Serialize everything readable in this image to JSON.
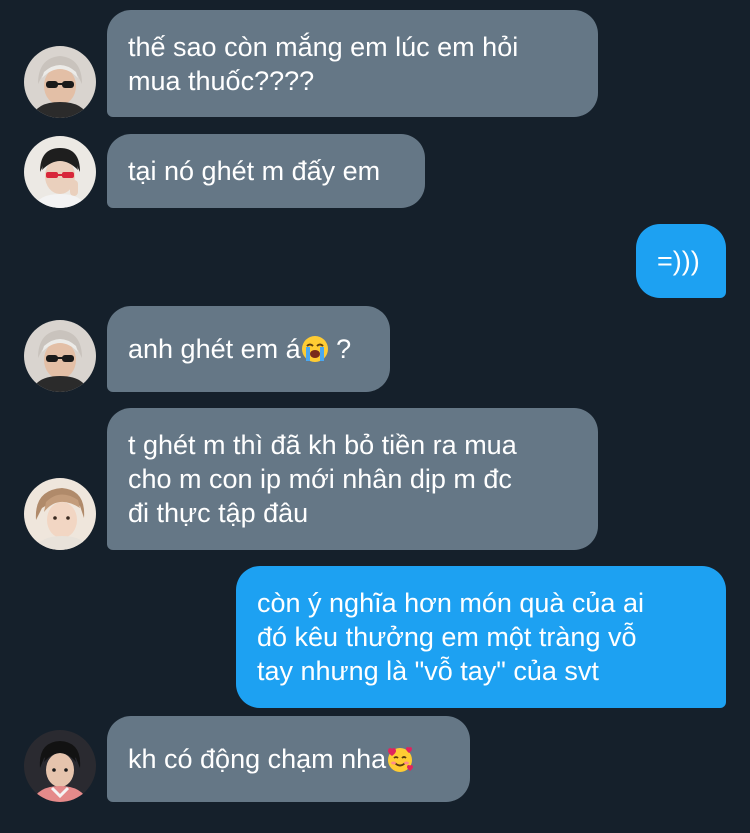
{
  "messages": [
    {
      "sender": "them",
      "avatar": "avatar-silver-hair-sunglasses",
      "lines": [
        "thế sao còn mắng em lúc em hỏi",
        "mua thuốc????"
      ]
    },
    {
      "sender": "them",
      "avatar": "avatar-red-sunglasses",
      "lines": [
        "tại nó ghét m đấy em"
      ]
    },
    {
      "sender": "me",
      "lines": [
        "=)))"
      ]
    },
    {
      "sender": "them",
      "avatar": "avatar-silver-hair-sunglasses",
      "lines": [
        "anh ghét em á",
        " ?"
      ],
      "emoji": "loudly-crying-face-emoji"
    },
    {
      "sender": "them",
      "avatar": "avatar-light-portrait",
      "lines": [
        "t ghét m thì đã kh bỏ tiền ra mua",
        "cho m con ip mới nhân dịp m đc",
        "đi thực tập đâu"
      ]
    },
    {
      "sender": "me",
      "lines": [
        "còn ý nghĩa hơn món quà của ai",
        "đó kêu thưởng em một tràng vỗ",
        "tay nhưng là \"vỗ tay\" của svt"
      ]
    },
    {
      "sender": "them",
      "avatar": "avatar-dark-hair-pink-shirt",
      "lines": [
        "kh có động chạm nha"
      ],
      "emoji": "smiling-face-with-hearts-emoji"
    }
  ],
  "colors": {
    "background": "#15202b",
    "incoming_bubble": "#657786",
    "outgoing_bubble": "#1da1f2",
    "text": "#ffffff"
  }
}
